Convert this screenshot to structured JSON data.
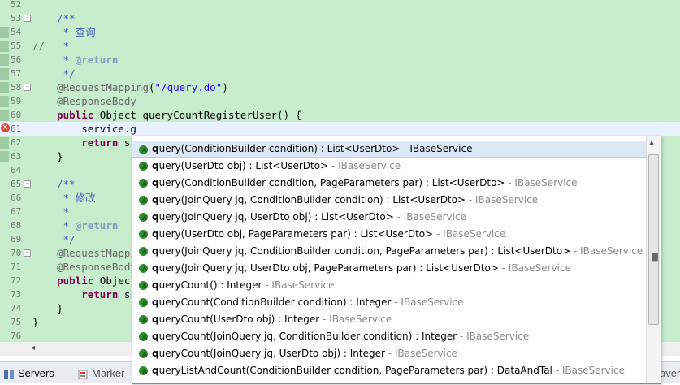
{
  "editor": {
    "lines": [
      {
        "n": "52",
        "html": ""
      },
      {
        "n": "53",
        "fold": "-",
        "parts": [
          [
            "c",
            "    /**"
          ]
        ]
      },
      {
        "n": "54",
        "parts": [
          [
            "c",
            "     * 查询"
          ]
        ]
      },
      {
        "n": "55",
        "parts": [
          [
            "sl",
            "//"
          ],
          [
            "c",
            "   *"
          ]
        ]
      },
      {
        "n": "56",
        "parts": [
          [
            "c",
            "     * "
          ],
          [
            "ct",
            "@return"
          ]
        ]
      },
      {
        "n": "57",
        "parts": [
          [
            "c",
            "     */"
          ]
        ]
      },
      {
        "n": "58",
        "fold": "-",
        "parts": [
          [
            "a",
            "    @RequestMapping"
          ],
          [
            "pln",
            "("
          ],
          [
            "s",
            "\"/query.do\""
          ],
          [
            "pln",
            ")"
          ]
        ]
      },
      {
        "n": "59",
        "parts": [
          [
            "a",
            "    @ResponseBody"
          ]
        ]
      },
      {
        "n": "60",
        "parts": [
          [
            "k",
            "    public "
          ],
          [
            "pln",
            "Object queryCountRegisterUser() {"
          ]
        ]
      },
      {
        "n": "61",
        "current": true,
        "error": true,
        "parts": [
          [
            "pln",
            "        service.g"
          ]
        ]
      },
      {
        "n": "62",
        "parts": [
          [
            "k",
            "        return "
          ],
          [
            "pln",
            "s"
          ]
        ]
      },
      {
        "n": "63",
        "parts": [
          [
            "pln",
            "    }"
          ]
        ]
      },
      {
        "n": "64",
        "parts": []
      },
      {
        "n": "65",
        "fold": "-",
        "parts": [
          [
            "c",
            "    /**"
          ]
        ]
      },
      {
        "n": "66",
        "parts": [
          [
            "c",
            "     * 修改"
          ]
        ]
      },
      {
        "n": "67",
        "parts": [
          [
            "c",
            "     *"
          ]
        ]
      },
      {
        "n": "68",
        "parts": [
          [
            "c",
            "     * "
          ],
          [
            "ct",
            "@return"
          ]
        ]
      },
      {
        "n": "69",
        "parts": [
          [
            "c",
            "     */"
          ]
        ]
      },
      {
        "n": "70",
        "fold": "-",
        "parts": [
          [
            "a",
            "    @RequestMappi"
          ]
        ]
      },
      {
        "n": "71",
        "parts": [
          [
            "a",
            "    @ResponseBody"
          ]
        ]
      },
      {
        "n": "72",
        "parts": [
          [
            "k",
            "    public "
          ],
          [
            "pln",
            "Objec"
          ]
        ]
      },
      {
        "n": "73",
        "parts": [
          [
            "k",
            "        return "
          ],
          [
            "pln",
            "s"
          ]
        ]
      },
      {
        "n": "74",
        "parts": [
          [
            "pln",
            "    }"
          ]
        ]
      },
      {
        "n": "75",
        "parts": [
          [
            "pln",
            "}"
          ]
        ]
      },
      {
        "n": "76",
        "parts": []
      }
    ]
  },
  "bottom_tabs": [
    {
      "label": "Servers",
      "icon": "servers-icon"
    },
    {
      "label": "Marker",
      "icon": "markers-icon"
    },
    {
      "label": "averse",
      "icon": "traverse-icon"
    }
  ],
  "completion": {
    "items": [
      {
        "bold": "q",
        "rest": "uery(ConditionBuilder condition) : List<UserDto>",
        "iface": "IBaseService",
        "selected": true
      },
      {
        "bold": "q",
        "rest": "uery(UserDto obj) : List<UserDto>",
        "iface": "IBaseService"
      },
      {
        "bold": "q",
        "rest": "uery(ConditionBuilder condition, PageParameters par) : List<UserDto>",
        "iface": "IBaseService"
      },
      {
        "bold": "q",
        "rest": "uery(JoinQuery jq, ConditionBuilder condition) : List<UserDto>",
        "iface": "IBaseService"
      },
      {
        "bold": "q",
        "rest": "uery(JoinQuery jq, UserDto obj) : List<UserDto>",
        "iface": "IBaseService"
      },
      {
        "bold": "q",
        "rest": "uery(UserDto obj, PageParameters par) : List<UserDto>",
        "iface": "IBaseService"
      },
      {
        "bold": "q",
        "rest": "uery(JoinQuery jq, ConditionBuilder condition, PageParameters par) : List<UserDto>",
        "iface": "IBaseService"
      },
      {
        "bold": "q",
        "rest": "uery(JoinQuery jq, UserDto obj, PageParameters par) : List<UserDto>",
        "iface": "IBaseService"
      },
      {
        "bold": "q",
        "rest": "ueryCount() : Integer",
        "iface": "IBaseService"
      },
      {
        "bold": "q",
        "rest": "ueryCount(ConditionBuilder condition) : Integer",
        "iface": "IBaseService"
      },
      {
        "bold": "q",
        "rest": "ueryCount(UserDto obj) : Integer",
        "iface": "IBaseService"
      },
      {
        "bold": "q",
        "rest": "ueryCount(JoinQuery jq, ConditionBuilder condition) : Integer",
        "iface": "IBaseService"
      },
      {
        "bold": "q",
        "rest": "ueryCount(JoinQuery jq, UserDto obj) : Integer",
        "iface": "IBaseService"
      },
      {
        "bold": "q",
        "rest": "ueryListAndCount(ConditionBuilder condition, PageParameters par) : DataAndTal",
        "iface": "IBaseService"
      }
    ],
    "separator": " - "
  }
}
